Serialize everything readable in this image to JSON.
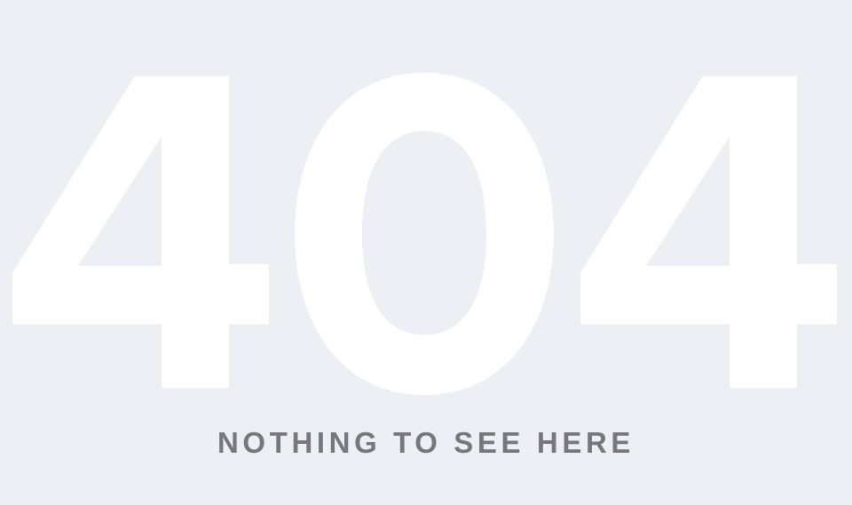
{
  "error": {
    "code": "404",
    "message": "NOTHING TO SEE HERE"
  },
  "colors": {
    "background": "#eeeff4",
    "code": "#ffffff",
    "message": "#77777d"
  }
}
